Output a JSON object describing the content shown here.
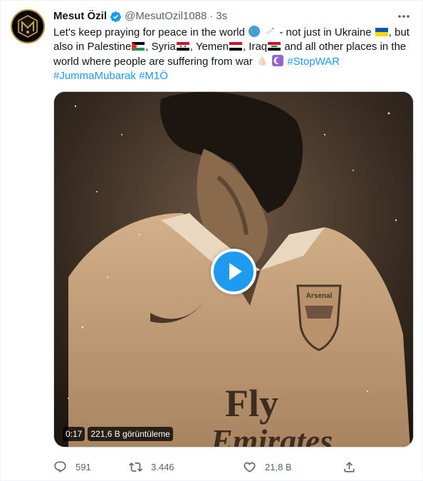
{
  "author": {
    "name": "Mesut Özil",
    "handle": "@MesutOzil1088",
    "separator": "·",
    "time": "3s",
    "verified": true
  },
  "tweet": {
    "line1_a": "Let's keep praying for peace in the world",
    "line1_b": "- not just in Ukraine",
    "line1_c": ", but",
    "line2_a": "also in Palestine",
    "line2_b": ", Syria",
    "line2_c": ", Yemen",
    "line2_d": ", Iraq",
    "line2_e": " and all other places in the",
    "line3_a": "world where people are suffering from war",
    "hashtag_stopwar": "#StopWAR",
    "hashtag_jumma": "#JummaMubarak",
    "hashtag_m10": "#M1Ö",
    "emojis": [
      "globe-icon",
      "dove-icon",
      "flag-ukraine",
      "flag-palestine",
      "flag-syria",
      "flag-yemen",
      "flag-iraq",
      "praying-hands-icon",
      "crescent-icon"
    ]
  },
  "media": {
    "type": "video",
    "duration": "0:17",
    "views": "221,6 B görüntüleme",
    "jersey_text": "Fly",
    "sponsor_text": "Emirates",
    "crest_text": "Arsenal"
  },
  "actions": {
    "replies": "591",
    "retweets": "3.446",
    "likes": "21,8 B"
  },
  "colors": {
    "accent": "#1d9bf0",
    "secondary_text": "#536471",
    "primary_text": "#0f1419",
    "sepia": "#8a6a4c"
  }
}
